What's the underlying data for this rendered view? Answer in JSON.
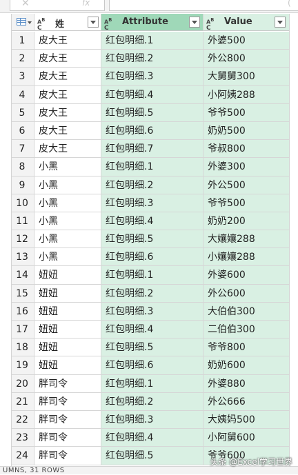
{
  "toolbar": {
    "cancel_glyph": "✕",
    "fx_label": "fx",
    "formula_tail": "("
  },
  "header": {
    "col1": "姓",
    "col2": "Attribute",
    "col3": "Value",
    "type_icon": "ABC"
  },
  "rows": [
    {
      "n": "1",
      "name": "皮大王",
      "attr": "红包明细.1",
      "val": "外婆500"
    },
    {
      "n": "2",
      "name": "皮大王",
      "attr": "红包明细.2",
      "val": "外公800"
    },
    {
      "n": "3",
      "name": "皮大王",
      "attr": "红包明细.3",
      "val": "大舅舅300"
    },
    {
      "n": "4",
      "name": "皮大王",
      "attr": "红包明细.4",
      "val": "小阿姨288"
    },
    {
      "n": "5",
      "name": "皮大王",
      "attr": "红包明细.5",
      "val": "爷爷500"
    },
    {
      "n": "6",
      "name": "皮大王",
      "attr": "红包明细.6",
      "val": "奶奶500"
    },
    {
      "n": "7",
      "name": "皮大王",
      "attr": "红包明细.7",
      "val": "爷叔800"
    },
    {
      "n": "8",
      "name": "小黑",
      "attr": "红包明细.1",
      "val": "外婆300"
    },
    {
      "n": "9",
      "name": "小黑",
      "attr": "红包明细.2",
      "val": "外公500"
    },
    {
      "n": "10",
      "name": "小黑",
      "attr": "红包明细.3",
      "val": "爷爷500"
    },
    {
      "n": "11",
      "name": "小黑",
      "attr": "红包明细.4",
      "val": "奶奶200"
    },
    {
      "n": "12",
      "name": "小黑",
      "attr": "红包明细.5",
      "val": "大孃孃288"
    },
    {
      "n": "13",
      "name": "小黑",
      "attr": "红包明细.6",
      "val": "小孃孃288"
    },
    {
      "n": "14",
      "name": "妞妞",
      "attr": "红包明细.1",
      "val": "外婆600"
    },
    {
      "n": "15",
      "name": "妞妞",
      "attr": "红包明细.2",
      "val": "外公600"
    },
    {
      "n": "16",
      "name": "妞妞",
      "attr": "红包明细.3",
      "val": "大伯伯300"
    },
    {
      "n": "17",
      "name": "妞妞",
      "attr": "红包明细.4",
      "val": "二伯伯300"
    },
    {
      "n": "18",
      "name": "妞妞",
      "attr": "红包明细.5",
      "val": "爷爷800"
    },
    {
      "n": "19",
      "name": "妞妞",
      "attr": "红包明细.6",
      "val": "奶奶600"
    },
    {
      "n": "20",
      "name": "胖司令",
      "attr": "红包明细.1",
      "val": "外婆880"
    },
    {
      "n": "21",
      "name": "胖司令",
      "attr": "红包明细.2",
      "val": "外公666"
    },
    {
      "n": "22",
      "name": "胖司令",
      "attr": "红包明细.3",
      "val": "大姨妈500"
    },
    {
      "n": "23",
      "name": "胖司令",
      "attr": "红包明细.4",
      "val": "小阿舅600"
    },
    {
      "n": "24",
      "name": "胖司令",
      "attr": "红包明细.5",
      "val": "爷爷600"
    }
  ],
  "status": {
    "text": "UMNS, 31 ROWS"
  },
  "watermark": {
    "text": "头条 @Excel学习世界"
  },
  "colors": {
    "selected_header": "#9fd8b8",
    "column_tint": "#d9f0e3",
    "row_number_bg": "#f3f3f3"
  }
}
